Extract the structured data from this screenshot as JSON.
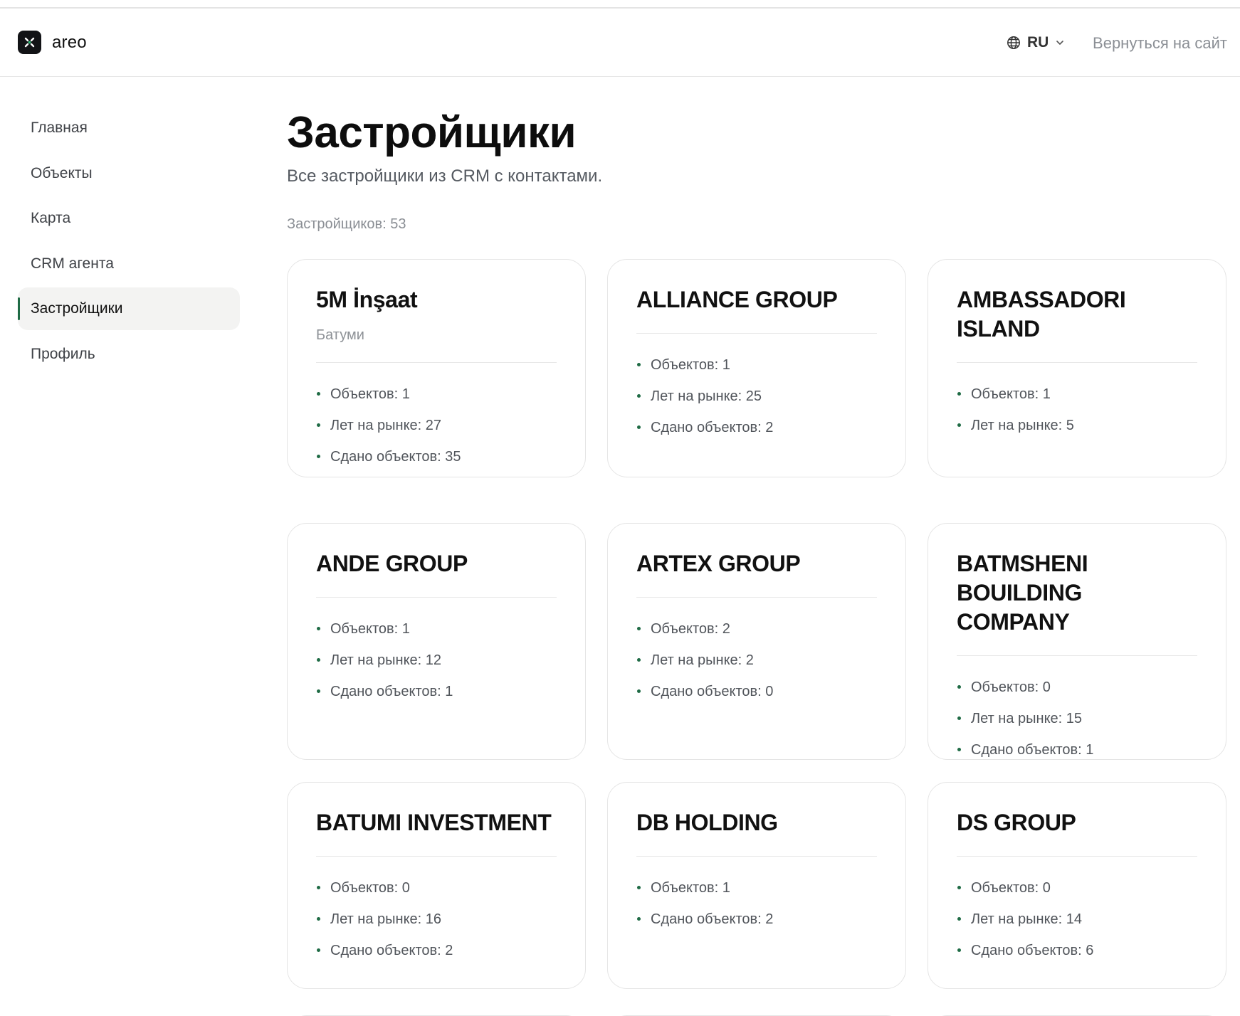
{
  "header": {
    "brand_name": "areo",
    "language": "RU",
    "back_link": "Вернуться на сайт"
  },
  "sidebar": {
    "items": [
      {
        "label": "Главная",
        "active": false
      },
      {
        "label": "Объекты",
        "active": false
      },
      {
        "label": "Карта",
        "active": false
      },
      {
        "label": "CRM агента",
        "active": false
      },
      {
        "label": "Застройщики",
        "active": true
      },
      {
        "label": "Профиль",
        "active": false
      }
    ]
  },
  "main": {
    "title": "Застройщики",
    "subtitle": "Все застройщики из CRM с контактами.",
    "count_label": "Застройщиков: 53"
  },
  "developers": [
    {
      "name": "5M İnşaat",
      "city": "Батуми",
      "stats": [
        "Объектов: 1",
        "Лет на рынке: 27",
        "Сдано объектов: 35"
      ]
    },
    {
      "name": "ALLIANCE GROUP",
      "stats": [
        "Объектов: 1",
        "Лет на рынке: 25",
        "Сдано объектов: 2"
      ]
    },
    {
      "name": "AMBASSADORI ISLAND",
      "stats": [
        "Объектов: 1",
        "Лет на рынке: 5"
      ]
    },
    {
      "name": "ANDE GROUP",
      "stats": [
        "Объектов: 1",
        "Лет на рынке: 12",
        "Сдано объектов: 1"
      ]
    },
    {
      "name": "ARTEX GROUP",
      "stats": [
        "Объектов: 2",
        "Лет на рынке: 2",
        "Сдано объектов: 0"
      ]
    },
    {
      "name": "BATMSHENI BOUILDING COMPANY",
      "stats": [
        "Объектов: 0",
        "Лет на рынке: 15",
        "Сдано объектов: 1"
      ]
    },
    {
      "name": "BATUMI INVESTMENT",
      "stats": [
        "Объектов: 0",
        "Лет на рынке: 16",
        "Сдано объектов: 2"
      ]
    },
    {
      "name": "DB HOLDING",
      "stats": [
        "Объектов: 1",
        "Сдано объектов: 2"
      ]
    },
    {
      "name": "DS GROUP",
      "stats": [
        "Объектов: 0",
        "Лет на рынке: 14",
        "Сдано объектов: 6"
      ]
    }
  ],
  "colors": {
    "accent": "#1f6b45",
    "active_nav_bg": "#f3f3f2",
    "muted_text": "#8a8e94"
  },
  "icons": {
    "logo": "areo-logo-icon",
    "language": "globe-icon",
    "dropdown": "chevron-down-icon"
  }
}
